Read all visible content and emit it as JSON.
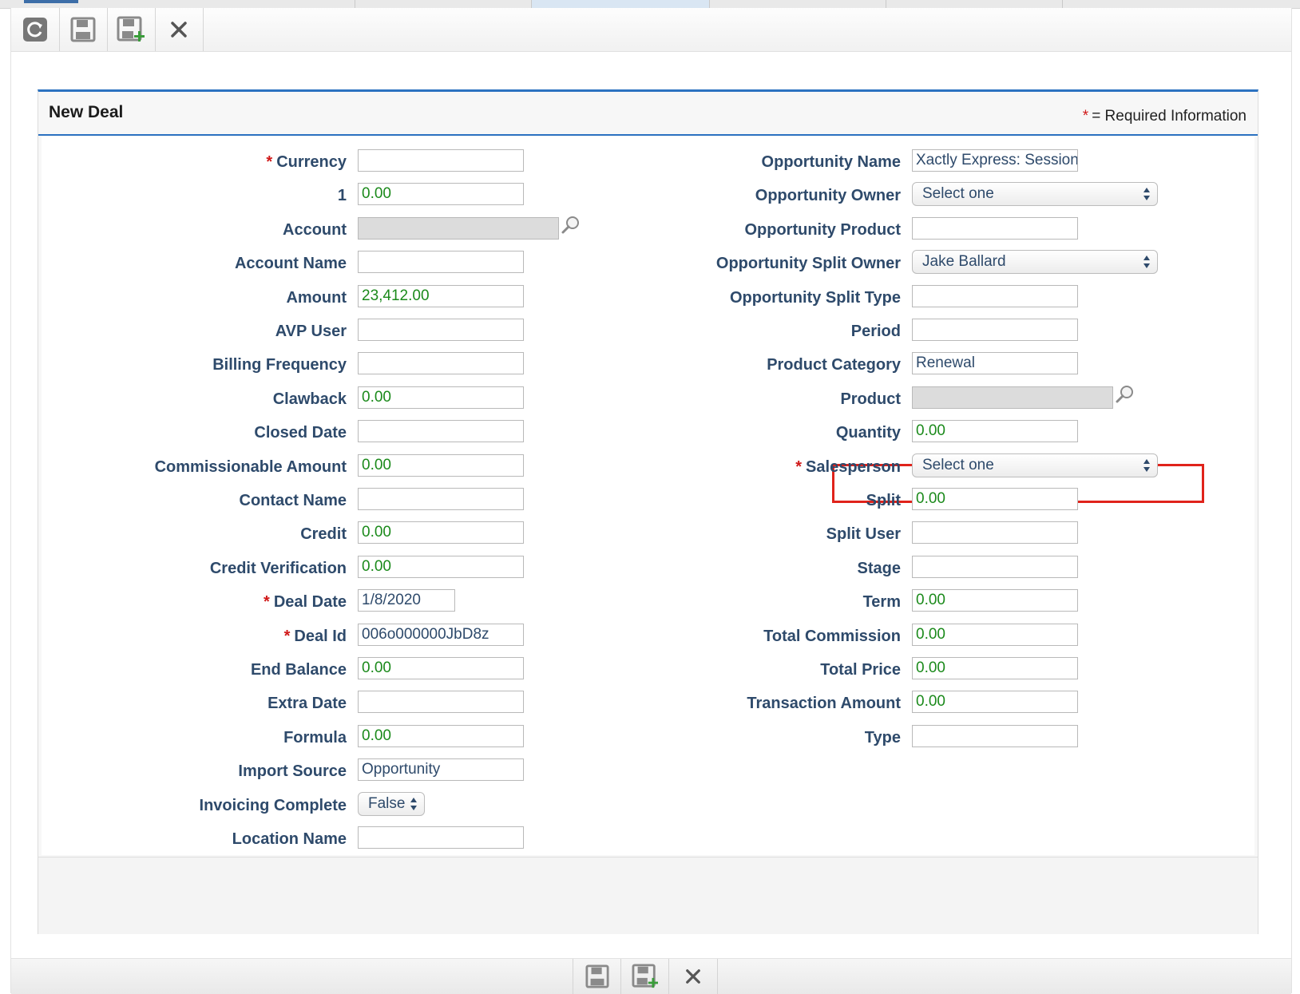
{
  "panel": {
    "title": "New Deal",
    "required_star": "*",
    "required_note": "= Required Information"
  },
  "toolbar": {
    "buttons": [
      {
        "name": "refresh-icon"
      },
      {
        "name": "save-icon"
      },
      {
        "name": "save-and-new-icon"
      },
      {
        "name": "close-icon"
      }
    ]
  },
  "left_fields": [
    {
      "label": "Currency",
      "required": true,
      "value": ""
    },
    {
      "label": "1",
      "value": "0.00"
    },
    {
      "label": "Account",
      "value": ""
    },
    {
      "label": "Account Name",
      "value": ""
    },
    {
      "label": "Amount",
      "value": "23,412.00"
    },
    {
      "label": "AVP User",
      "value": ""
    },
    {
      "label": "Billing Frequency",
      "value": ""
    },
    {
      "label": "Clawback",
      "value": "0.00"
    },
    {
      "label": "Closed Date",
      "value": ""
    },
    {
      "label": "Commissionable Amount",
      "value": "0.00"
    },
    {
      "label": "Contact Name",
      "value": ""
    },
    {
      "label": "Credit",
      "value": "0.00"
    },
    {
      "label": "Credit Verification",
      "value": "0.00"
    },
    {
      "label": "Deal Date",
      "required": true,
      "value": "1/8/2020"
    },
    {
      "label": "Deal Id",
      "required": true,
      "value": "006o000000JbD8z"
    },
    {
      "label": "End Balance",
      "value": "0.00"
    },
    {
      "label": "Extra Date",
      "value": ""
    },
    {
      "label": "Formula",
      "value": "0.00"
    },
    {
      "label": "Import Source",
      "value": "Opportunity"
    },
    {
      "label": "Invoicing Complete",
      "value": "False"
    },
    {
      "label": "Location Name",
      "value": ""
    }
  ],
  "right_fields": [
    {
      "label": "Opportunity Name",
      "value": "Xactly Express: Session"
    },
    {
      "label": "Opportunity Owner",
      "value": "Select one"
    },
    {
      "label": "Opportunity Product",
      "value": ""
    },
    {
      "label": "Opportunity Split Owner",
      "value": "Jake Ballard"
    },
    {
      "label": "Opportunity Split Type",
      "value": ""
    },
    {
      "label": "Period",
      "value": ""
    },
    {
      "label": "Product Category",
      "value": "Renewal"
    },
    {
      "label": "Product",
      "value": ""
    },
    {
      "label": "Quantity",
      "value": "0.00"
    },
    {
      "label": "Salesperson",
      "required": true,
      "value": "Select one"
    },
    {
      "label": "Split",
      "value": "0.00"
    },
    {
      "label": "Split User",
      "value": ""
    },
    {
      "label": "Stage",
      "value": ""
    },
    {
      "label": "Term",
      "value": "0.00"
    },
    {
      "label": "Total Commission",
      "value": "0.00"
    },
    {
      "label": "Total Price",
      "value": "0.00"
    },
    {
      "label": "Transaction Amount",
      "value": "0.00"
    },
    {
      "label": "Type",
      "value": ""
    }
  ],
  "colors": {
    "label": "#2e4a6b",
    "numeric_value": "#1b8a1b",
    "required_star": "#d01818",
    "accent": "#2c72c1",
    "highlight": "#e0231b"
  }
}
